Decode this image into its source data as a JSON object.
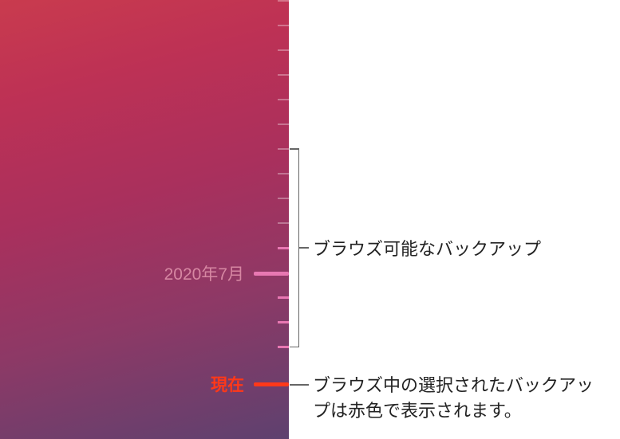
{
  "timeline": {
    "date_label": "2020年7月",
    "now_label": "現在"
  },
  "callouts": {
    "browsable": "ブラウズ可能なバックアップ",
    "selected": "ブラウズ中の選択されたバックアップは赤色で表示されます。"
  }
}
